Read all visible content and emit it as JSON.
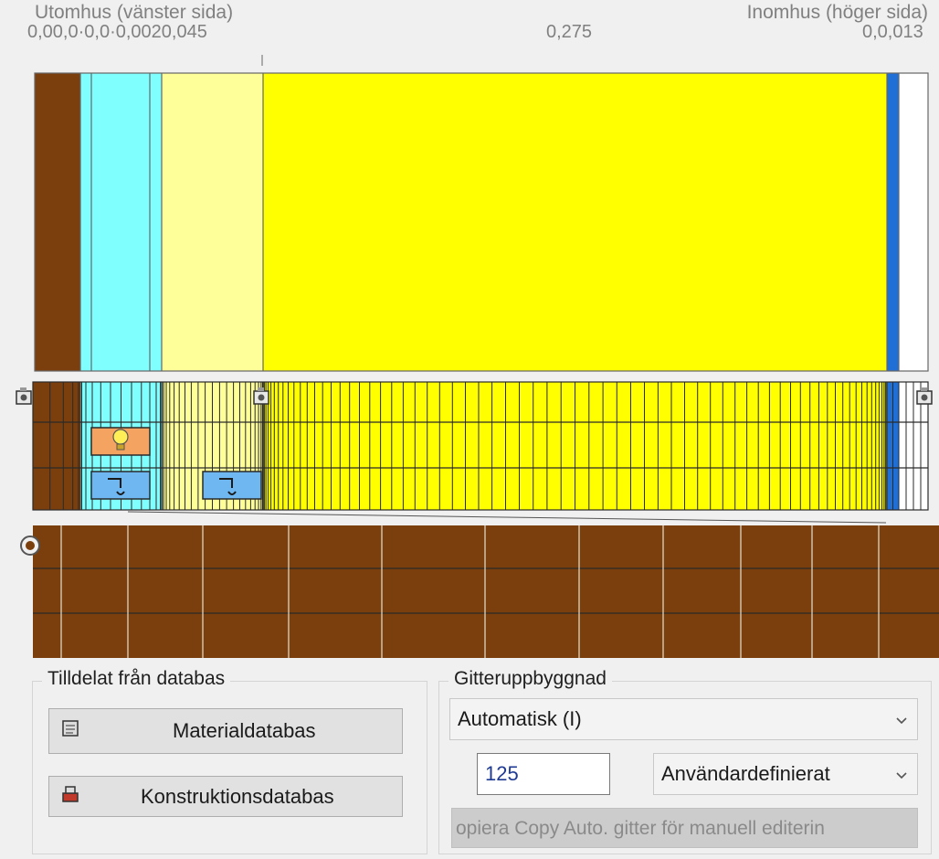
{
  "header": {
    "left_label": "Utomhus (vänster sida)",
    "right_label": "Inomhus (höger sida)"
  },
  "thickness_labels": {
    "left": "0,00,0·0,0·0,0020,045",
    "middle": "0,275",
    "right": "0,0,013"
  },
  "layers": [
    {
      "name": "brown",
      "color": "#7a3f0c"
    },
    {
      "name": "thin-1",
      "color": "#80ffff"
    },
    {
      "name": "cyan",
      "color": "#80ffff"
    },
    {
      "name": "pale-yellow",
      "color": "#ffff99"
    },
    {
      "name": "yellow",
      "color": "#ffff00"
    },
    {
      "name": "blue",
      "color": "#1f6fd6"
    },
    {
      "name": "white",
      "color": "#ffffff"
    }
  ],
  "colors": {
    "brown": "#7a3f0c",
    "cyan": "#80ffff",
    "pale_yellow": "#ffff99",
    "yellow": "#ffff00",
    "blue": "#1f6fd6",
    "source_orange": "#f4a460",
    "source_blue": "#6fb7f0"
  },
  "icons": {
    "layer_marker": "camera-marker-icon",
    "heat_source": "lightbulb-icon",
    "moisture_source": "faucet-icon",
    "monitor_point": "target-circle-icon"
  },
  "database_group": {
    "title": "Tilldelat från databas",
    "material_button": "Materialdatabas",
    "construction_button": "Konstruktionsdatabas"
  },
  "grid_group": {
    "title": "Gitteruppbyggnad",
    "mode_select": "Automatisk (I)",
    "grid_count": "125",
    "type_select": "Användardefinierat",
    "copy_button": "opiera Copy Auto. gitter för manuell editerin"
  }
}
